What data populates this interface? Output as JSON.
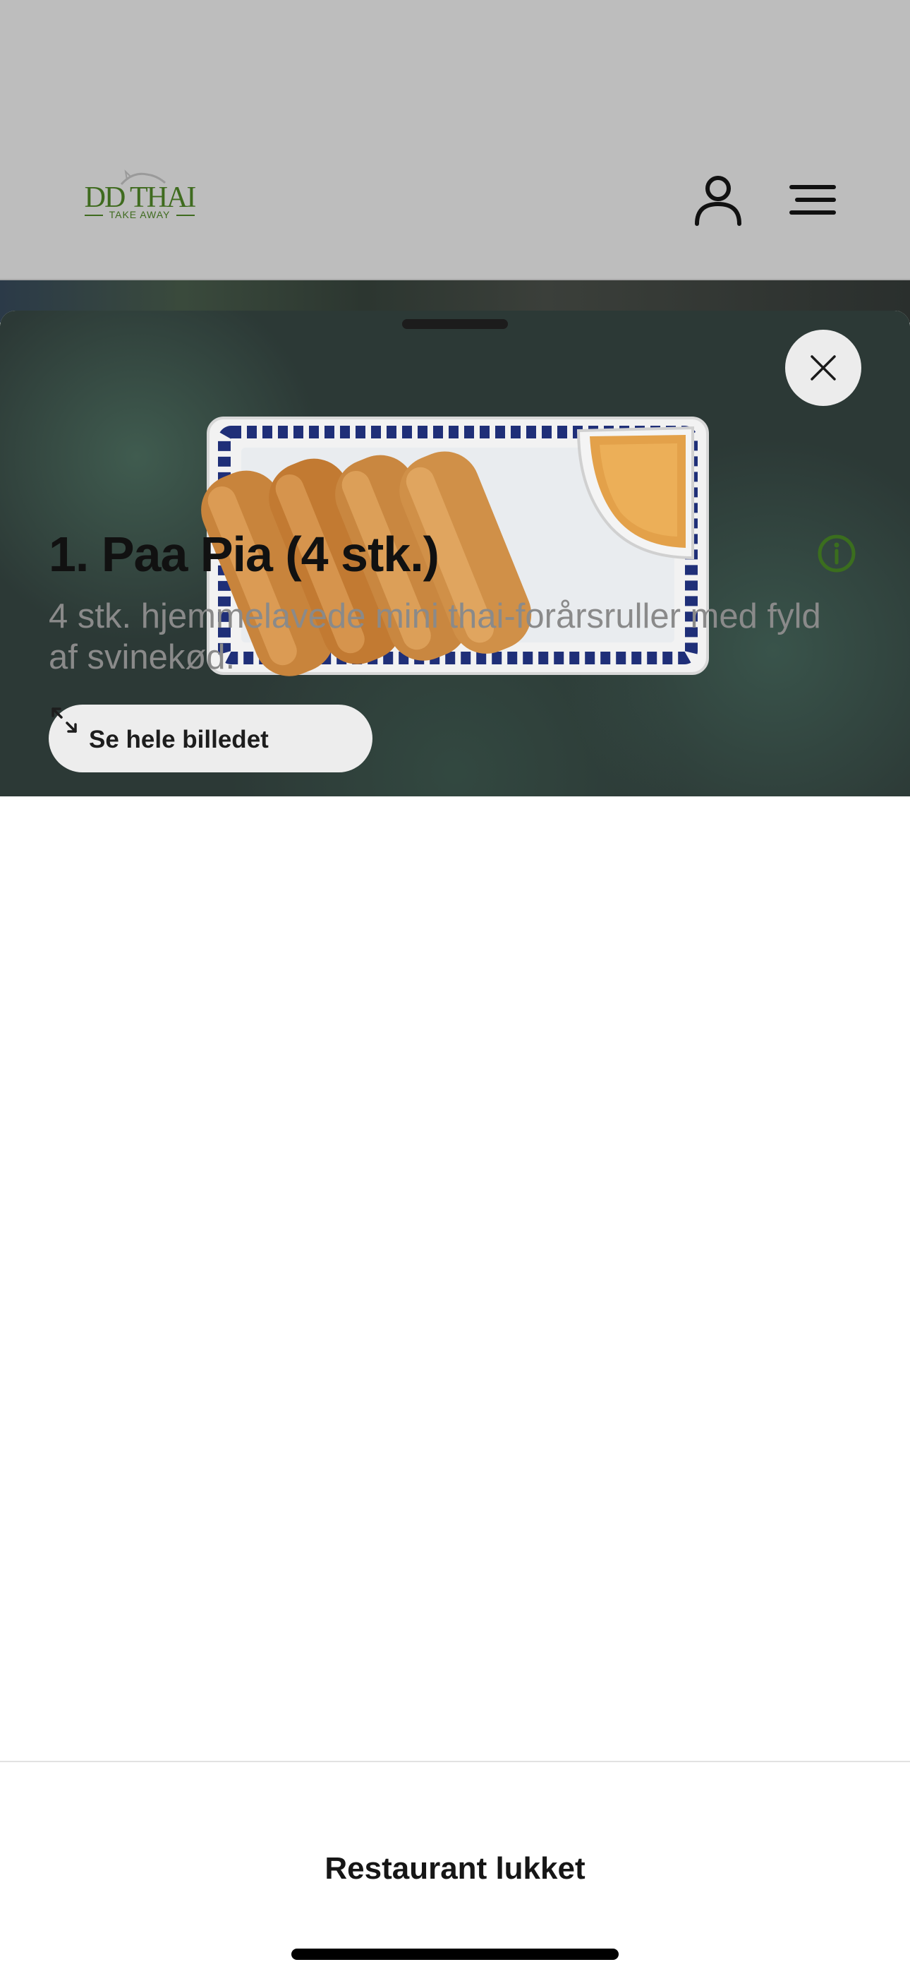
{
  "header": {
    "logo": {
      "name": "DD THAI",
      "subtitle": "TAKE AWAY"
    },
    "icons": [
      "user-icon",
      "menu-icon"
    ]
  },
  "item_sheet": {
    "see_image_label": "Se hele billedet",
    "title": "1. Paa Pia (4 stk.)",
    "description": "4 stk. hjemmelavede mini thai-forårsruller med fyld af svinekød.",
    "icons": [
      "close-icon",
      "expand-icon",
      "info-icon"
    ]
  },
  "footer": {
    "status_label": "Restaurant lukket"
  },
  "colors": {
    "brand_green": "#3f6b1f",
    "header_bg": "#bdbdbd",
    "info_icon": "#3b6e1e"
  }
}
